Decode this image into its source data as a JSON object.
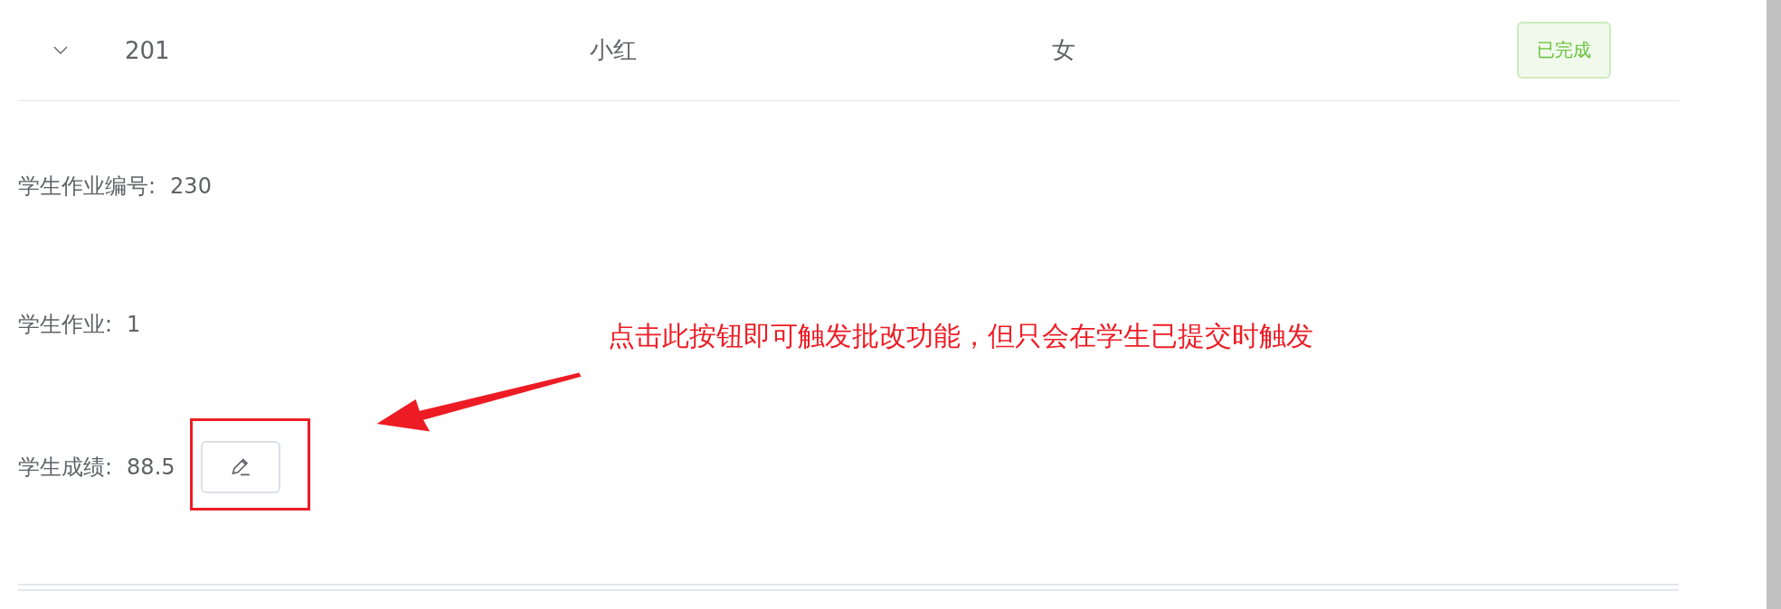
{
  "row": {
    "expanded": true,
    "id": "201",
    "name": "小红",
    "gender": "女",
    "status": {
      "label": "已完成",
      "color": "#67c23a"
    }
  },
  "details": [
    {
      "label": "学生作业编号:",
      "value": "230",
      "kind": "text"
    },
    {
      "label": "学生作业:",
      "value": "1",
      "kind": "text"
    },
    {
      "label": "学生成绩:",
      "value": "88.5",
      "kind": "grade"
    }
  ],
  "annotation": {
    "text": "点击此按钮即可触发批改功能，但只会在学生已提交时触发"
  }
}
